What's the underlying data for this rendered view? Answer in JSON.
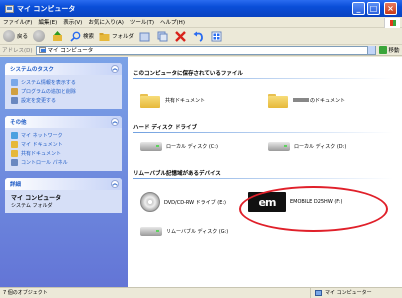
{
  "window": {
    "title": "マイ コンピュータ",
    "controls": [
      "_",
      "□",
      "×"
    ]
  },
  "menu": [
    "ファイル(F)",
    "編集(E)",
    "表示(V)",
    "お気に入り(A)",
    "ツール(T)",
    "ヘルプ(H)"
  ],
  "toolbar": {
    "back": "戻る",
    "search": "検索",
    "folders": "フォルダ"
  },
  "address": {
    "label": "アドレス(D)",
    "value": "マイ コンピュータ",
    "go": "移動"
  },
  "left_panels": {
    "system_tasks": {
      "title": "システムのタスク",
      "items": [
        "システム情報を表示する",
        "プログラムの追加と削除",
        "設定を変更する"
      ]
    },
    "other_places": {
      "title": "その他",
      "items": [
        "マイ ネットワーク",
        "マイ ドキュメント",
        "共有ドキュメント",
        "コントロール パネル"
      ]
    },
    "details": {
      "title": "詳細",
      "name": "マイ コンピュータ",
      "type": "システム フォルダ"
    }
  },
  "sections": {
    "stored_files": "このコンピュータに保存されているファイル",
    "hard_disks": "ハード ディスク ドライブ",
    "removable": "リムーバブル記憶域があるデバイス"
  },
  "items": {
    "shared_docs": "共有ドキュメント",
    "user_docs": "のドキュメント",
    "local_c": "ローカル ディスク (C:)",
    "local_d": "ローカル ディスク (D:)",
    "dvd": "DVD/CD-RW ドライブ (E:)",
    "emobile": "EMOBILE D25HW (F:)",
    "removable_g": "リムーバブル ディスク (G:)"
  },
  "status": {
    "left": "7 個のオブジェクト",
    "right": "マイ コンピューター"
  }
}
